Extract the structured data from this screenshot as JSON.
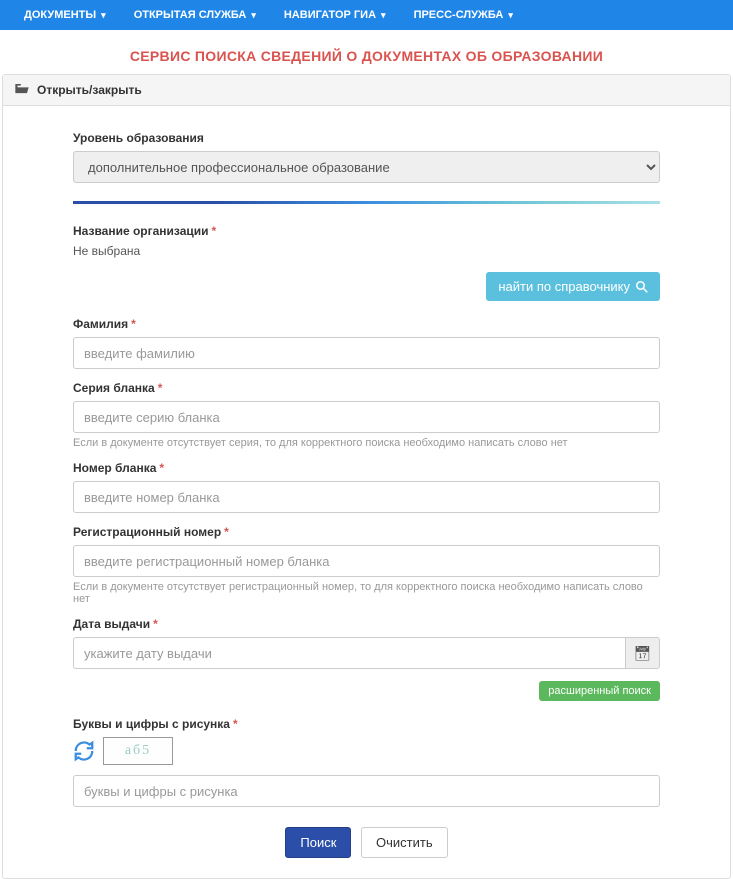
{
  "navbar": {
    "items": [
      {
        "label": "ДОКУМЕНТЫ"
      },
      {
        "label": "ОТКРЫТАЯ СЛУЖБА"
      },
      {
        "label": "НАВИГАТОР ГИА"
      },
      {
        "label": "ПРЕСС-СЛУЖБА"
      }
    ]
  },
  "page_title": "СЕРВИС ПОИСКА СВЕДЕНИЙ О ДОКУМЕНТАХ ОБ ОБРАЗОВАНИИ",
  "panel": {
    "heading": "Открыть/закрыть"
  },
  "form": {
    "education_level": {
      "label": "Уровень образования",
      "selected": "дополнительное профессиональное образование"
    },
    "organization": {
      "label": "Название организации",
      "not_selected": "Не выбрана",
      "lookup_button": "найти по справочнику"
    },
    "surname": {
      "label": "Фамилия",
      "placeholder": "введите фамилию"
    },
    "blank_series": {
      "label": "Серия бланка",
      "placeholder": "введите серию бланка",
      "help": "Если в документе отсутствует серия, то для корректного поиска необходимо написать слово нет"
    },
    "blank_number": {
      "label": "Номер бланка",
      "placeholder": "введите номер бланка"
    },
    "reg_number": {
      "label": "Регистрационный номер",
      "placeholder": "введите регистрационный номер бланка",
      "help": "Если в документе отсутствует регистрационный номер, то для корректного поиска необходимо написать слово нет"
    },
    "issue_date": {
      "label": "Дата выдачи",
      "placeholder": "укажите дату выдачи"
    },
    "advanced_search": "расширенный поиск",
    "captcha": {
      "label": "Буквы и цифры с рисунка",
      "placeholder": "буквы и цифры с рисунка",
      "image_text": "аб5"
    },
    "submit": "Поиск",
    "clear": "Очистить"
  }
}
